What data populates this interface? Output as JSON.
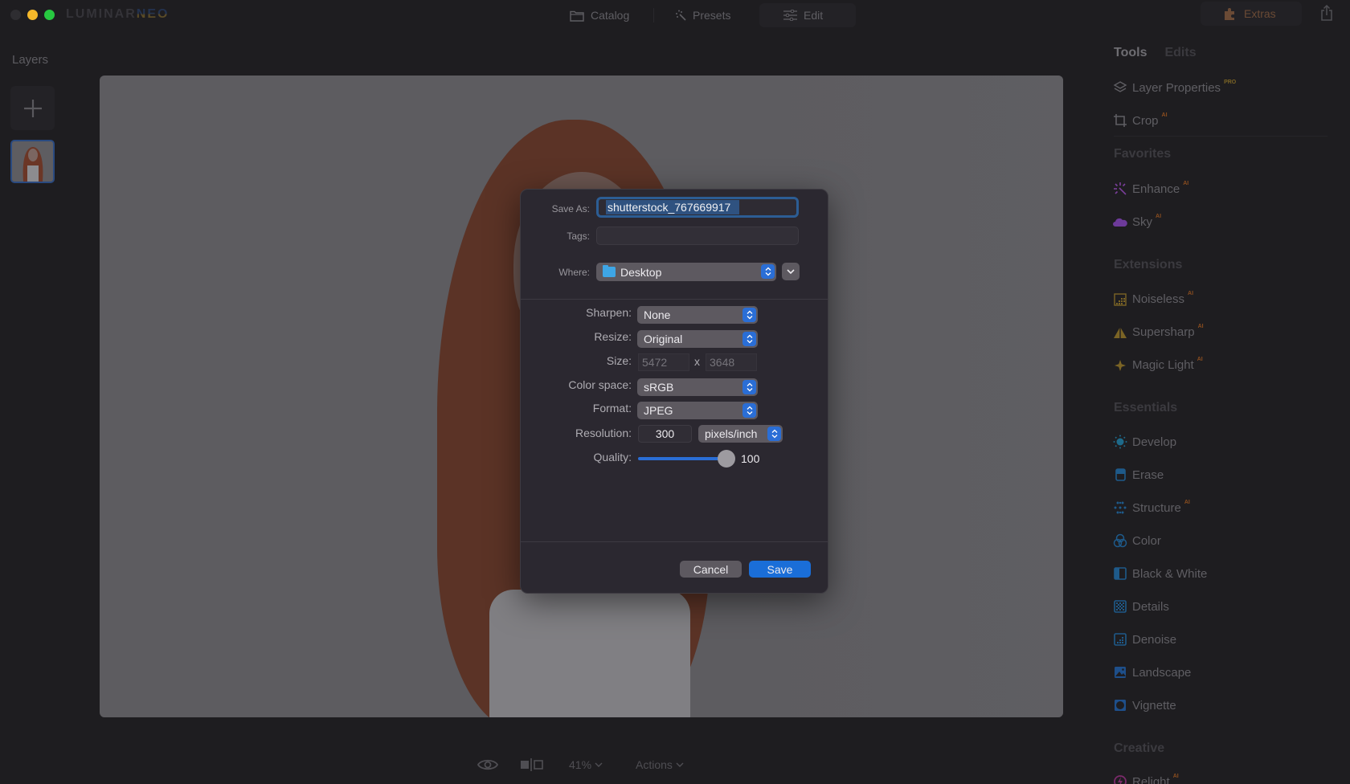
{
  "app": {
    "logo_left": "LUMINAR",
    "logo_right": "NEO"
  },
  "topnav": {
    "catalog": "Catalog",
    "presets": "Presets",
    "edit": "Edit",
    "extras": "Extras",
    "active": "Edit"
  },
  "layers": {
    "title": "Layers",
    "add_icon": "plus-icon",
    "thumbnail_selected": true
  },
  "bottombar": {
    "zoom": "41%",
    "actions": "Actions"
  },
  "right_panel": {
    "tabs": [
      {
        "label": "Tools",
        "active": true
      },
      {
        "label": "Edits",
        "active": false
      }
    ],
    "top_items": [
      {
        "label": "Layer Properties",
        "badge": "PRO",
        "icon": "layers-icon"
      },
      {
        "label": "Crop",
        "badge": "AI",
        "icon": "crop-icon"
      }
    ],
    "sections": [
      {
        "title": "Favorites",
        "items": [
          {
            "label": "Enhance",
            "badge": "AI",
            "icon": "enhance-sparkle-icon"
          },
          {
            "label": "Sky",
            "badge": "AI",
            "icon": "cloud-icon"
          }
        ]
      },
      {
        "title": "Extensions",
        "items": [
          {
            "label": "Noiseless",
            "badge": "AI",
            "icon": "noiseless-pro-icon"
          },
          {
            "label": "Supersharp",
            "badge": "AI",
            "icon": "supersharp-pro-icon"
          },
          {
            "label": "Magic Light",
            "badge": "AI",
            "icon": "magic-light-pro-icon"
          }
        ]
      },
      {
        "title": "Essentials",
        "items": [
          {
            "label": "Develop",
            "badge": "",
            "icon": "sun-icon"
          },
          {
            "label": "Erase",
            "badge": "",
            "icon": "eraser-icon"
          },
          {
            "label": "Structure",
            "badge": "AI",
            "icon": "dots-grid-icon"
          },
          {
            "label": "Color",
            "badge": "",
            "icon": "color-circles-icon"
          },
          {
            "label": "Black & White",
            "badge": "",
            "icon": "half-square-icon"
          },
          {
            "label": "Details",
            "badge": "",
            "icon": "checker-icon"
          },
          {
            "label": "Denoise",
            "badge": "",
            "icon": "denoise-icon"
          },
          {
            "label": "Landscape",
            "badge": "",
            "icon": "landscape-icon"
          },
          {
            "label": "Vignette",
            "badge": "",
            "icon": "vignette-icon"
          }
        ]
      },
      {
        "title": "Creative",
        "items": [
          {
            "label": "Relight",
            "badge": "AI",
            "icon": "relight-icon"
          }
        ]
      }
    ]
  },
  "dialog": {
    "save_as_label": "Save As:",
    "save_as_value": "shutterstock_767669917",
    "tags_label": "Tags:",
    "tags_value": "",
    "where_label": "Where:",
    "where_value": "Desktop",
    "sharpen_label": "Sharpen:",
    "sharpen_value": "None",
    "resize_label": "Resize:",
    "resize_value": "Original",
    "size_label": "Size:",
    "size_width": "5472",
    "size_x": "x",
    "size_height": "3648",
    "colorspace_label": "Color space:",
    "colorspace_value": "sRGB",
    "format_label": "Format:",
    "format_value": "JPEG",
    "resolution_label": "Resolution:",
    "resolution_value": "300",
    "resolution_unit": "pixels/inch",
    "quality_label": "Quality:",
    "quality_value": "100",
    "quality_fraction": 1.0,
    "cancel": "Cancel",
    "save": "Save"
  },
  "colors": {
    "accent_blue": "#1a6ed8",
    "ai_badge": "#8a4d1f",
    "pro_badge": "#7b6425"
  }
}
